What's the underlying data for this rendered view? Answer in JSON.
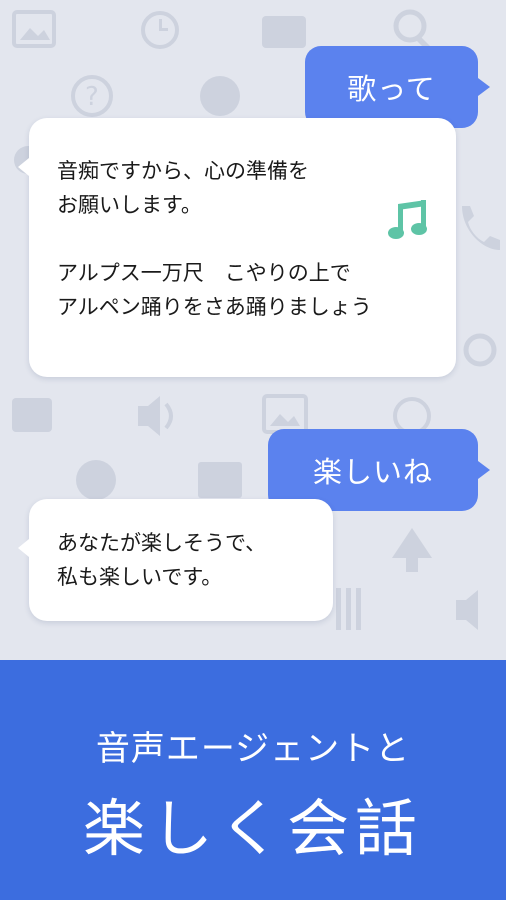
{
  "conversation": {
    "user_message_1": "歌って",
    "agent_reply_1": {
      "lines": [
        "音痴ですから、心の準備を",
        "お願いします。",
        "アルプス一万尺　こやりの上で",
        "アルペン踊りをさあ踊りましょう"
      ],
      "icon": "music-note-icon",
      "icon_color": "#5ec4a6"
    },
    "user_message_2": "楽しいね",
    "agent_reply_2": {
      "lines": [
        "あなたが楽しそうで、",
        "私も楽しいです。"
      ]
    }
  },
  "banner": {
    "subtitle": "音声エージェントと",
    "title": "楽しく会話"
  },
  "colors": {
    "user_bubble": "#5b82ee",
    "banner": "#3c6ddf",
    "background": "#e3e6ee",
    "icon_pattern": "#cdd2de"
  },
  "background_icons": [
    "image-icon",
    "clock-icon",
    "video-icon",
    "search-icon",
    "help-icon",
    "baseball-icon",
    "phone-icon",
    "speaker-icon",
    "newspaper-icon",
    "tree-icon",
    "cutlery-icon"
  ]
}
